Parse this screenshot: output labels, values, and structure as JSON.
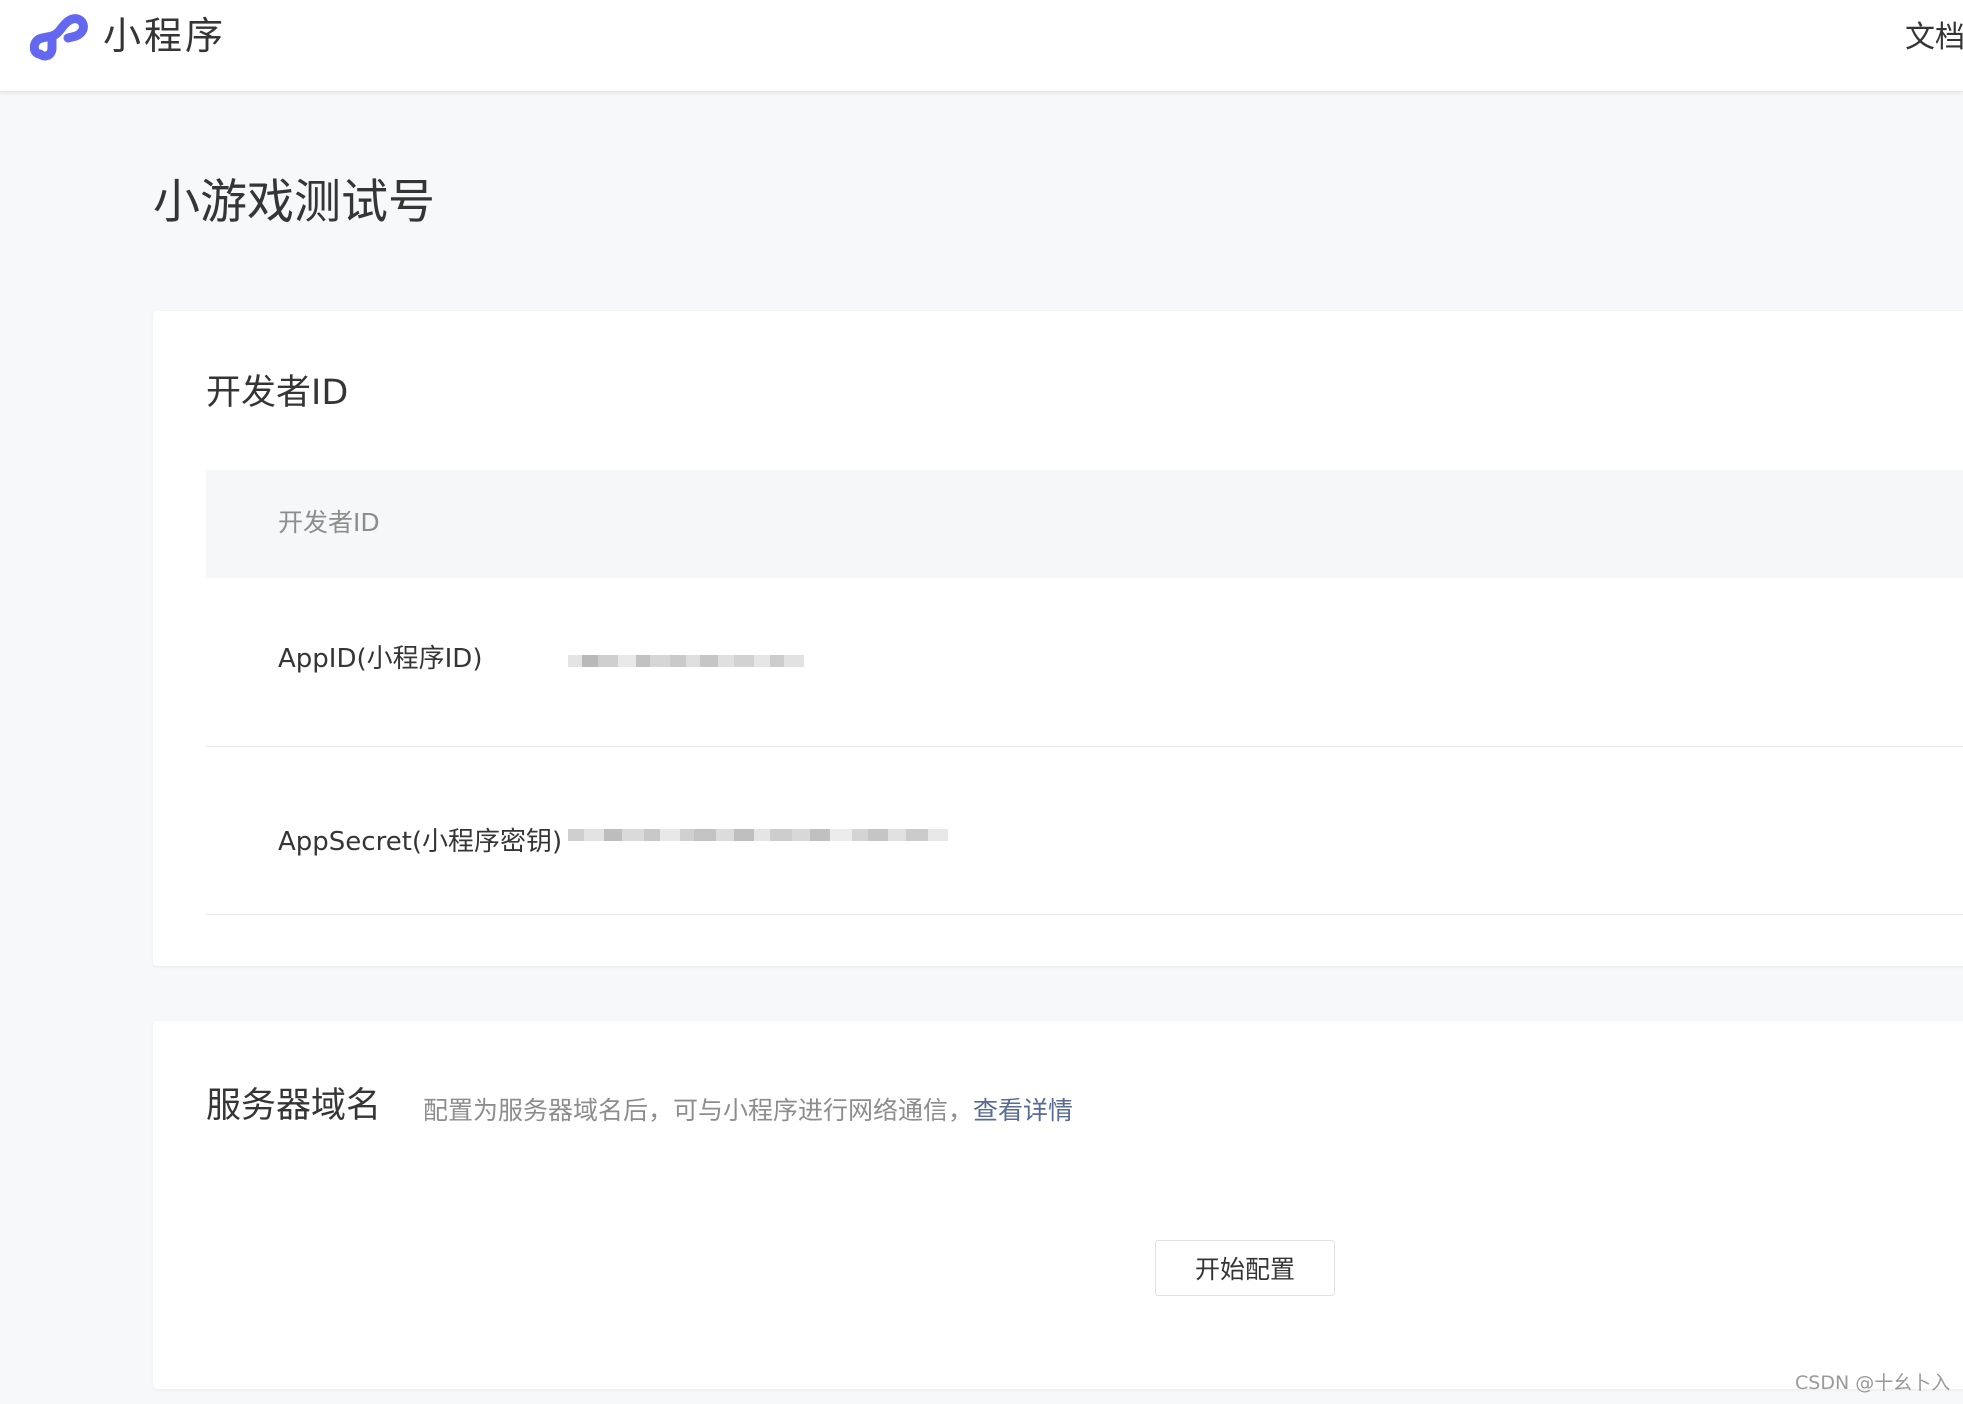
{
  "header": {
    "brand": "小程序",
    "nav_docs": "文档",
    "brand_color": "#6467f0"
  },
  "page": {
    "title": "小游戏测试号"
  },
  "developer_card": {
    "title": "开发者ID",
    "table_header": "开发者ID",
    "rows": [
      {
        "label": "AppID(小程序ID)",
        "value_state": "pixelated"
      },
      {
        "label": "AppSecret(小程序密钥)",
        "value_state": "pixelated"
      }
    ]
  },
  "server_card": {
    "title": "服务器域名",
    "description": "配置为服务器域名后，可与小程序进行网络通信，",
    "link_text": "查看详情",
    "link_color": "#576b95",
    "button_label": "开始配置"
  },
  "watermark": "CSDN @十幺卜入"
}
